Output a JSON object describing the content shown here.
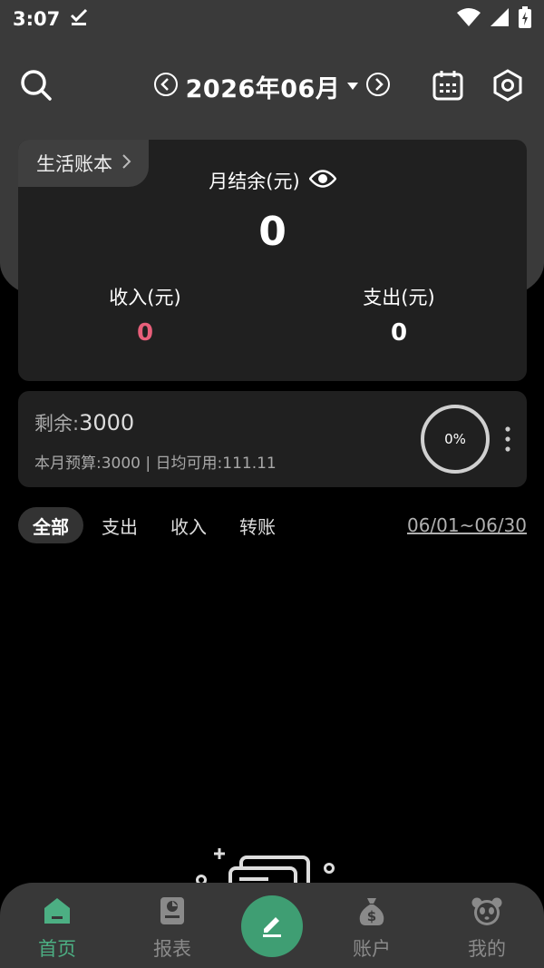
{
  "status_bar": {
    "time": "3:07"
  },
  "header": {
    "month": "2026年06月"
  },
  "book": {
    "name": "生活账本",
    "balance_label": "月结余(元)",
    "balance_value": "0",
    "income_label": "收入(元)",
    "income_value": "0",
    "expense_label": "支出(元)",
    "expense_value": "0"
  },
  "budget": {
    "remain_label": "剩余:",
    "remain_value": "3000",
    "detail": "本月预算:3000 | 日均可用:111.11",
    "percent": "0%"
  },
  "filters": {
    "tabs": [
      "全部",
      "支出",
      "收入",
      "转账"
    ],
    "date_range": "06/01~06/30"
  },
  "nav": {
    "home": "首页",
    "report": "报表",
    "account": "账户",
    "mine": "我的"
  },
  "colors": {
    "accent_green": "#4caf83",
    "income_red": "#e85f7a"
  }
}
